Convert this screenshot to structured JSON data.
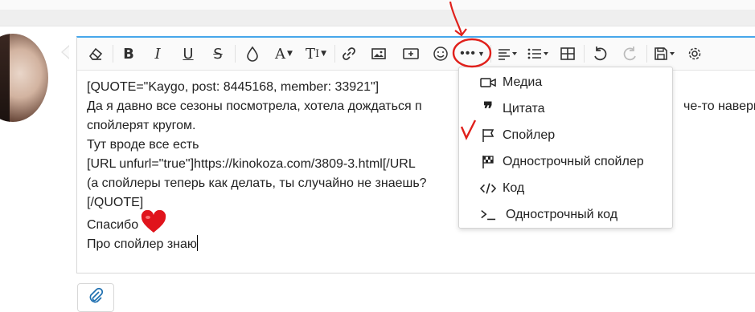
{
  "toolbar": {
    "buttons": [
      "remove-formatting",
      "bold",
      "italic",
      "underline",
      "strikethrough",
      "text-color",
      "font-family",
      "font-size",
      "link",
      "image",
      "media",
      "smilies",
      "more-options",
      "align",
      "list",
      "table",
      "undo",
      "redo",
      "drafts",
      "settings"
    ]
  },
  "editor": {
    "lines": [
      "[QUOTE=\"Kaygo, post: 8445168, member: 33921\"]",
      "Да я давно все сезоны посмотрела, хотела дождаться п",
      "спойлерят кругом.",
      "Тут вроде все есть",
      "[URL unfurl=\"true\"]https://kinokoza.com/3809-3.html[/URL",
      "(а спойлеры теперь как делать, ты случайно не знаешь?",
      "[/QUOTE]"
    ],
    "right_fragment": "че-то наверн",
    "thanks_text": "Спасибо",
    "last_line": "Про спойлер знаю"
  },
  "menu": {
    "items": [
      {
        "label": "Медиа",
        "icon": "video-icon"
      },
      {
        "label": "Цитата",
        "icon": "quote-icon"
      },
      {
        "label": "Спойлер",
        "icon": "flag-icon"
      },
      {
        "label": "Однострочный спойлер",
        "icon": "checkered-flag-icon"
      },
      {
        "label": "Код",
        "icon": "code-icon"
      },
      {
        "label": "Однострочный код",
        "icon": "terminal-icon"
      }
    ]
  },
  "colors": {
    "accent": "#47a7eb",
    "annotation": "#e0201b",
    "heart": "#e0141c"
  }
}
